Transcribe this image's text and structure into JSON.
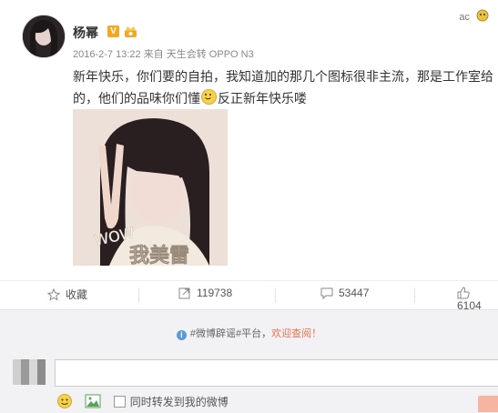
{
  "post": {
    "username": "杨幂",
    "verified_badge": "V",
    "timestamp": "2016-2-7 13:22",
    "source_prefix": "来自",
    "source": "天生会转 OPPO N3",
    "text_line1": "新年快乐，你们要的自拍，我知道加的那几个图标很非主流，那是工作室给",
    "text_line2a": "的，他们的品味你们懂",
    "text_line2b": "反正新年快乐喽",
    "photo_sticker_text": "WOW",
    "photo_sticker_cn": "我美雷"
  },
  "actions": {
    "favorite_label": "收藏",
    "repost_count": "119738",
    "comment_count": "53447",
    "like_count": "6104"
  },
  "comment_box": {
    "notice_prefix": "#微博辟谣#平台，",
    "notice_link": "欢迎查阅！",
    "repost_checkbox_label": "同时转发到我的微博"
  },
  "corner_deco": "ac"
}
